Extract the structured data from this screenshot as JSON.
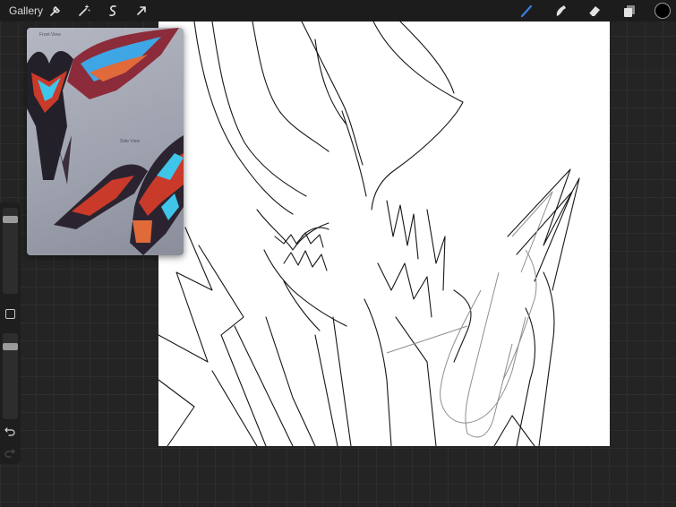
{
  "topbar": {
    "gallery_label": "Gallery",
    "left_tools": [
      {
        "name": "actions-wrench-icon"
      },
      {
        "name": "adjustments-wand-icon"
      },
      {
        "name": "selection-s-icon"
      },
      {
        "name": "transform-arrow-icon"
      }
    ],
    "right_tools": [
      {
        "name": "brush-icon",
        "active": true
      },
      {
        "name": "smudge-icon",
        "active": false
      },
      {
        "name": "eraser-icon",
        "active": false
      },
      {
        "name": "layers-icon",
        "active": false
      }
    ],
    "current_color": "#000000",
    "accent_color": "#3b7fe0"
  },
  "reference_window": {
    "labels": [
      "Front View",
      "Side View"
    ]
  },
  "sidebar": {
    "brush_size": 0.1,
    "brush_opacity": 0.12,
    "icons": [
      "modify-square-icon",
      "undo-icon",
      "redo-icon"
    ]
  }
}
